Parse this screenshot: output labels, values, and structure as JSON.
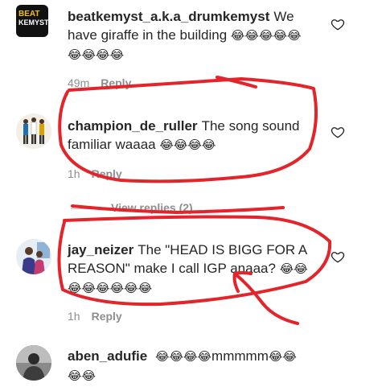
{
  "comments": [
    {
      "username": "beatkemyst_a.k.a_drumkemyst",
      "text": "We have giraffe in the building",
      "emojis": "😂😂😂😂😂😂😂😂😂",
      "time": "49m",
      "reply_label": "Reply",
      "avatar_text_top": "BEAT",
      "avatar_text_bottom": "KEMYST"
    },
    {
      "username": "champion_de_ruller",
      "text": "The song sound familiar waaaa",
      "emojis": "😂😂😂😂",
      "time": "1h",
      "reply_label": "Reply"
    },
    {
      "username": "jay_neizer",
      "text": "The \"HEAD IS BIGG FOR A REASON\" make I call IGP anaaa?",
      "emojis": "😂😂😂😂😂😂😂😂",
      "time": "1h",
      "reply_label": "Reply"
    },
    {
      "username": "aben_adufie",
      "text": "",
      "emojis_before": "😂😂😂😂",
      "text_after": "mmmmm",
      "emojis_after": "😂😂😂😂",
      "time": "",
      "reply_label": ""
    }
  ],
  "view_replies_label": "View replies (2)",
  "annotation_color": "#e3242b"
}
